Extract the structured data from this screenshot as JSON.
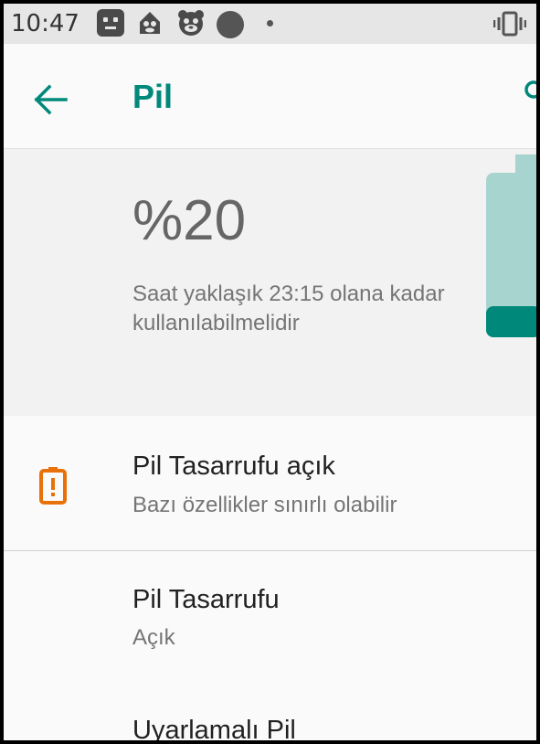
{
  "status_bar": {
    "time": "10:47",
    "icons": [
      "robot-icon",
      "monkey-icon",
      "bear-icon",
      "circle-icon",
      "dot-icon",
      "vibrate-icon"
    ]
  },
  "app_bar": {
    "title": "Pil",
    "back_icon": "arrow-left-icon",
    "search_icon": "search-icon"
  },
  "battery": {
    "percent_text": "%20",
    "level_percent": 20,
    "estimate": "Saat yaklaşık 23:15 olana kadar kullanılabilmelidir",
    "colors": {
      "fill": "#00897b",
      "empty": "#a8d4cf"
    }
  },
  "items": [
    {
      "title": "Pil Tasarrufu açık",
      "subtitle": "Bazı özellikler sınırlı olabilir",
      "icon": "battery-alert-icon",
      "icon_color": "#e8710a"
    },
    {
      "title": "Pil Tasarrufu",
      "subtitle": "Açık"
    },
    {
      "title": "Uyarlamalı Pil"
    }
  ],
  "colors": {
    "accent": "#00897b"
  }
}
